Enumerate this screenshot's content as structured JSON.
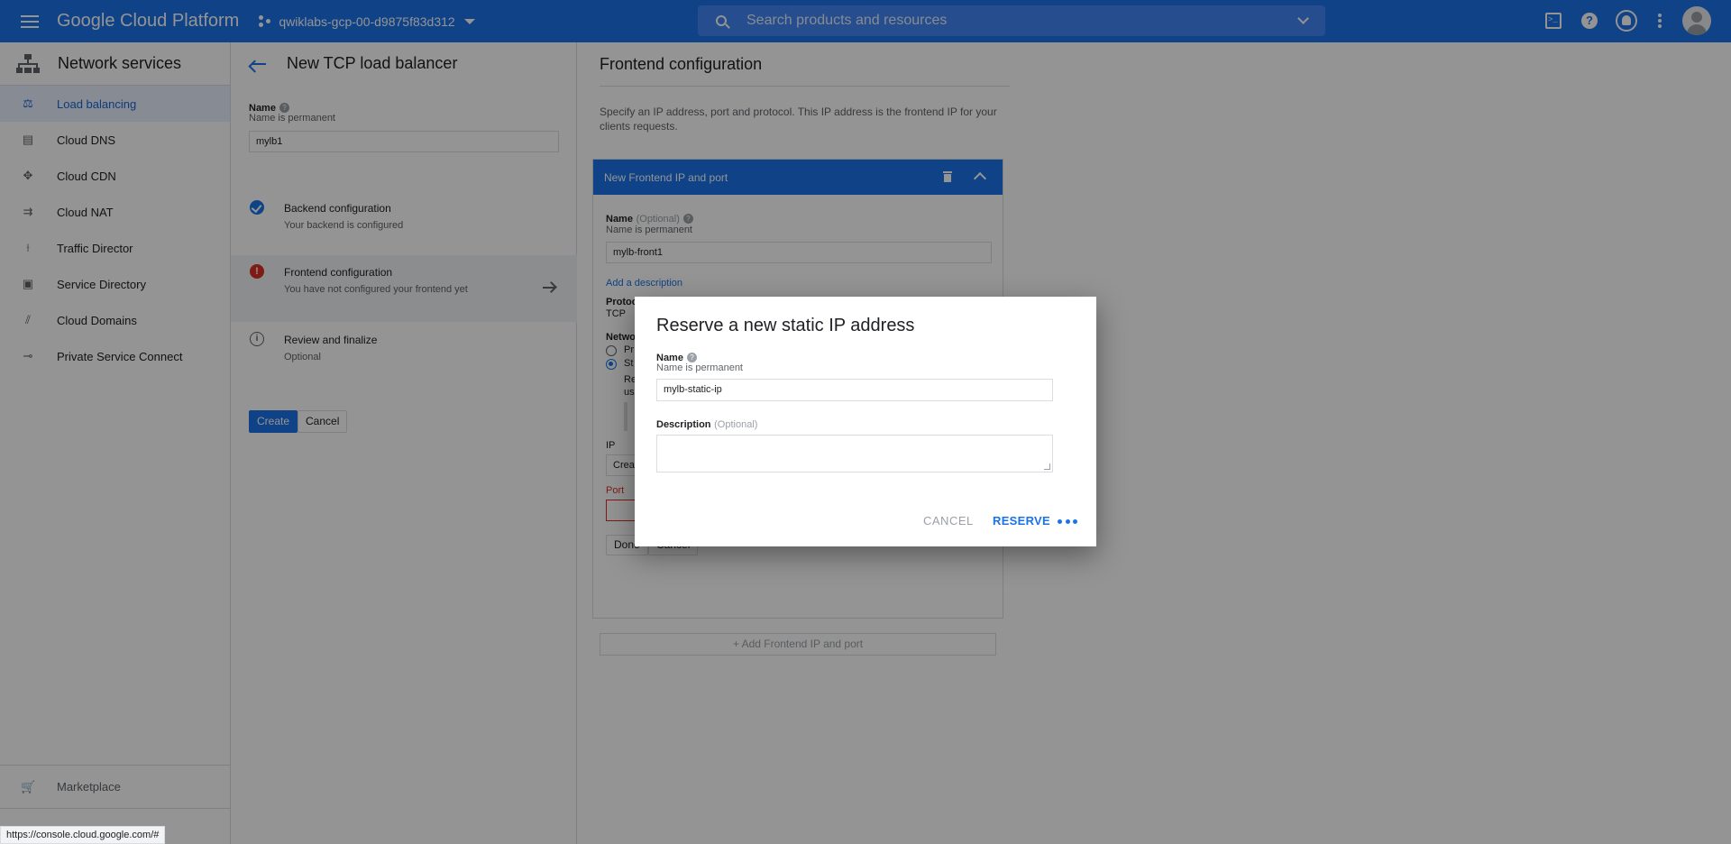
{
  "topbar": {
    "brand": "Google Cloud Platform",
    "project": "qwiklabs-gcp-00-d9875f83d312",
    "search_placeholder": "Search products and resources",
    "icons": [
      "menu-icon",
      "cloud-shell-icon",
      "help-icon",
      "notifications-icon",
      "more-vert-icon",
      "account-avatar"
    ]
  },
  "sidebar": {
    "title": "Network services",
    "items": [
      {
        "label": "Load balancing",
        "icon": "load-balancing-icon",
        "active": true
      },
      {
        "label": "Cloud DNS",
        "icon": "cloud-dns-icon"
      },
      {
        "label": "Cloud CDN",
        "icon": "cloud-cdn-icon"
      },
      {
        "label": "Cloud NAT",
        "icon": "cloud-nat-icon"
      },
      {
        "label": "Traffic Director",
        "icon": "traffic-director-icon"
      },
      {
        "label": "Service Directory",
        "icon": "service-directory-icon"
      },
      {
        "label": "Cloud Domains",
        "icon": "cloud-domains-icon"
      },
      {
        "label": "Private Service Connect",
        "icon": "private-service-connect-icon"
      }
    ],
    "marketplace": "Marketplace"
  },
  "wizard": {
    "title": "New TCP load balancer",
    "name_label": "Name",
    "name_sub": "Name is permanent",
    "name_value": "mylb1",
    "steps": [
      {
        "title": "Backend configuration",
        "sub": "Your backend is configured",
        "status": "done"
      },
      {
        "title": "Frontend configuration",
        "sub": "You have not configured your frontend yet",
        "status": "error"
      },
      {
        "title": "Review and finalize",
        "sub": "Optional",
        "status": "info"
      }
    ],
    "create_label": "Create",
    "cancel_label": "Cancel"
  },
  "frontend": {
    "title": "Frontend configuration",
    "description": "Specify an IP address, port and protocol. This IP address is the frontend IP for your clients requests.",
    "card_title": "New Frontend IP and port",
    "name_label": "Name",
    "name_optional": "(Optional)",
    "name_sub": "Name is permanent",
    "name_value": "mylb-front1",
    "add_description": "Add a description",
    "protocol_label": "Protoc",
    "protocol_value": "TCP",
    "network_label": "Netwo",
    "option_1_partial": "Pr",
    "option_2_partial": "St",
    "hint_partial_1": "Re",
    "hint_partial_2": "us",
    "ip_label": "IP",
    "ip_value_partial": "Crea",
    "port_label": "Port",
    "done_label": "Done",
    "cancel_label": "Cancel",
    "add_frontend": "+ Add Frontend IP and port"
  },
  "dialog": {
    "title": "Reserve a new static IP address",
    "name_label": "Name",
    "name_sub": "Name is permanent",
    "name_value": "mylb-static-ip",
    "desc_label": "Description",
    "desc_optional": "(Optional)",
    "cancel_label": "CANCEL",
    "reserve_label": "RESERVE"
  },
  "status_url": "https://console.cloud.google.com/#",
  "colors": {
    "accent": "#1a73e8",
    "error": "#d93025",
    "active_bg": "#e8f0fe"
  }
}
